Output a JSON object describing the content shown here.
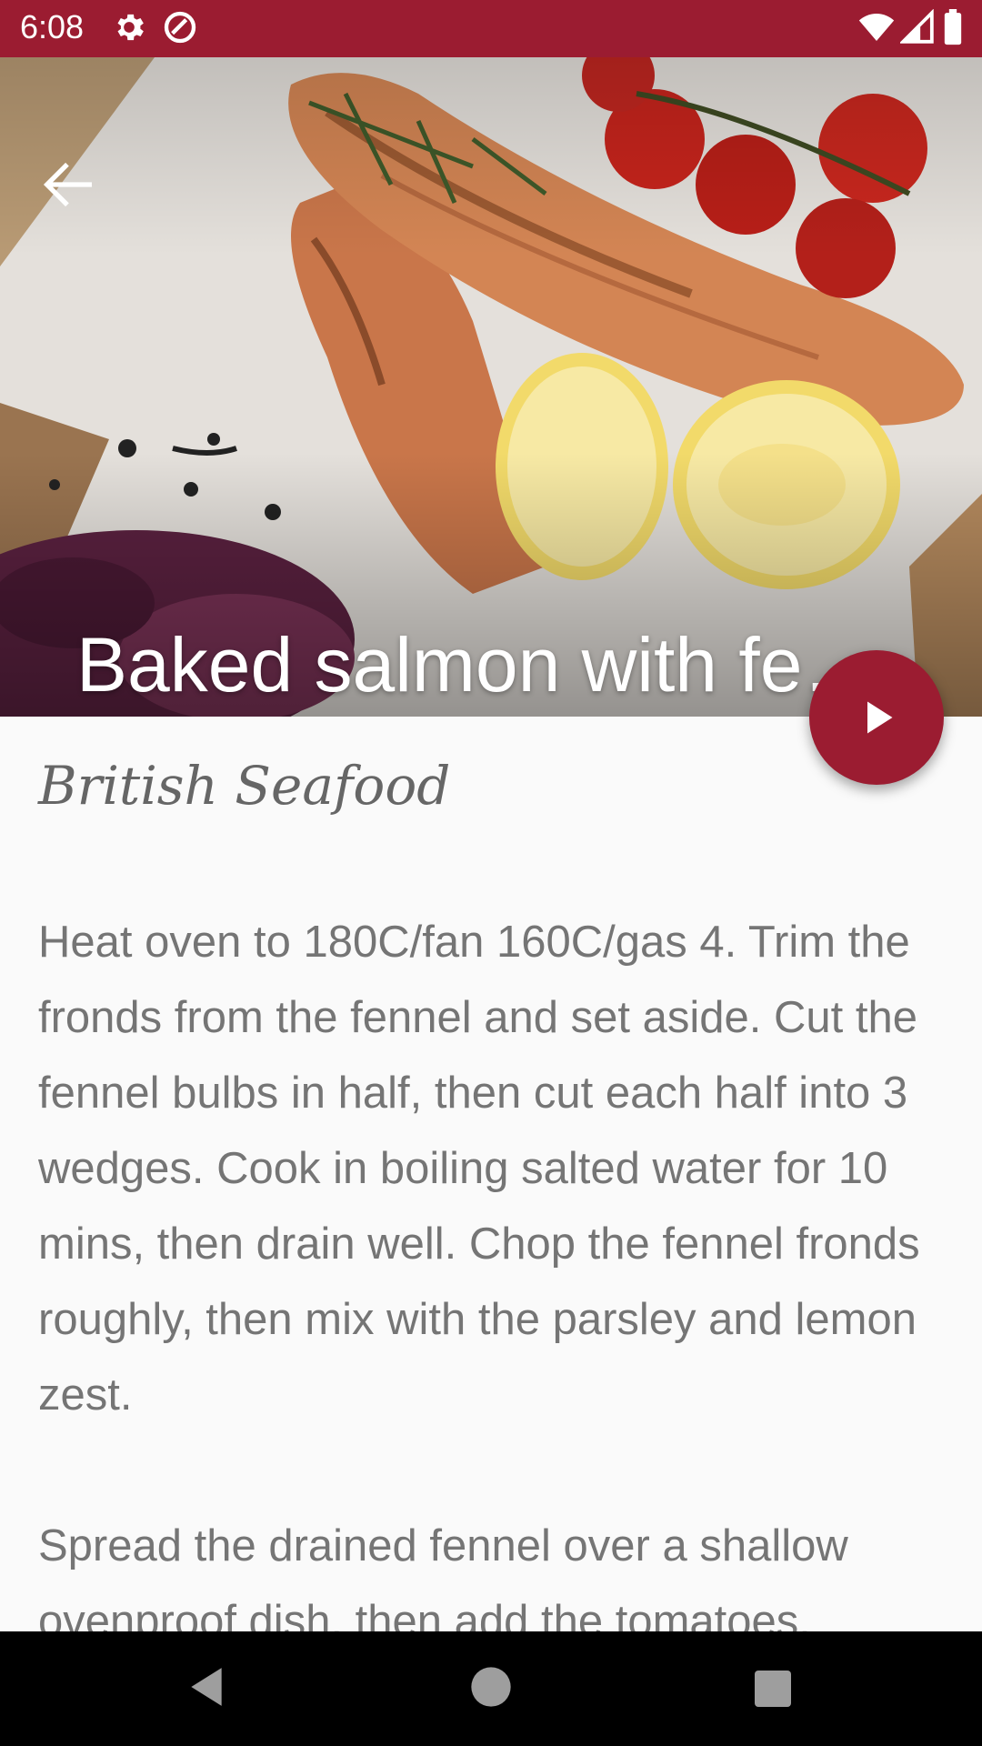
{
  "status_bar": {
    "time": "6:08"
  },
  "recipe": {
    "title": "Baked salmon with fennel & tomatoes",
    "category": "British Seafood",
    "instructions": "Heat oven to 180C/fan 160C/gas 4. Trim the fronds from the fennel and set aside. Cut the fennel bulbs in half, then cut each half into 3 wedges. Cook in boiling salted water for 10 mins, then drain well. Chop the fennel fronds roughly, then mix with the parsley and lemon zest.\n\nSpread the drained fennel over a shallow ovenproof dish, then add the tomatoes."
  },
  "colors": {
    "primary": "#9b1c31",
    "text": "#757575",
    "background": "#fafafa"
  }
}
